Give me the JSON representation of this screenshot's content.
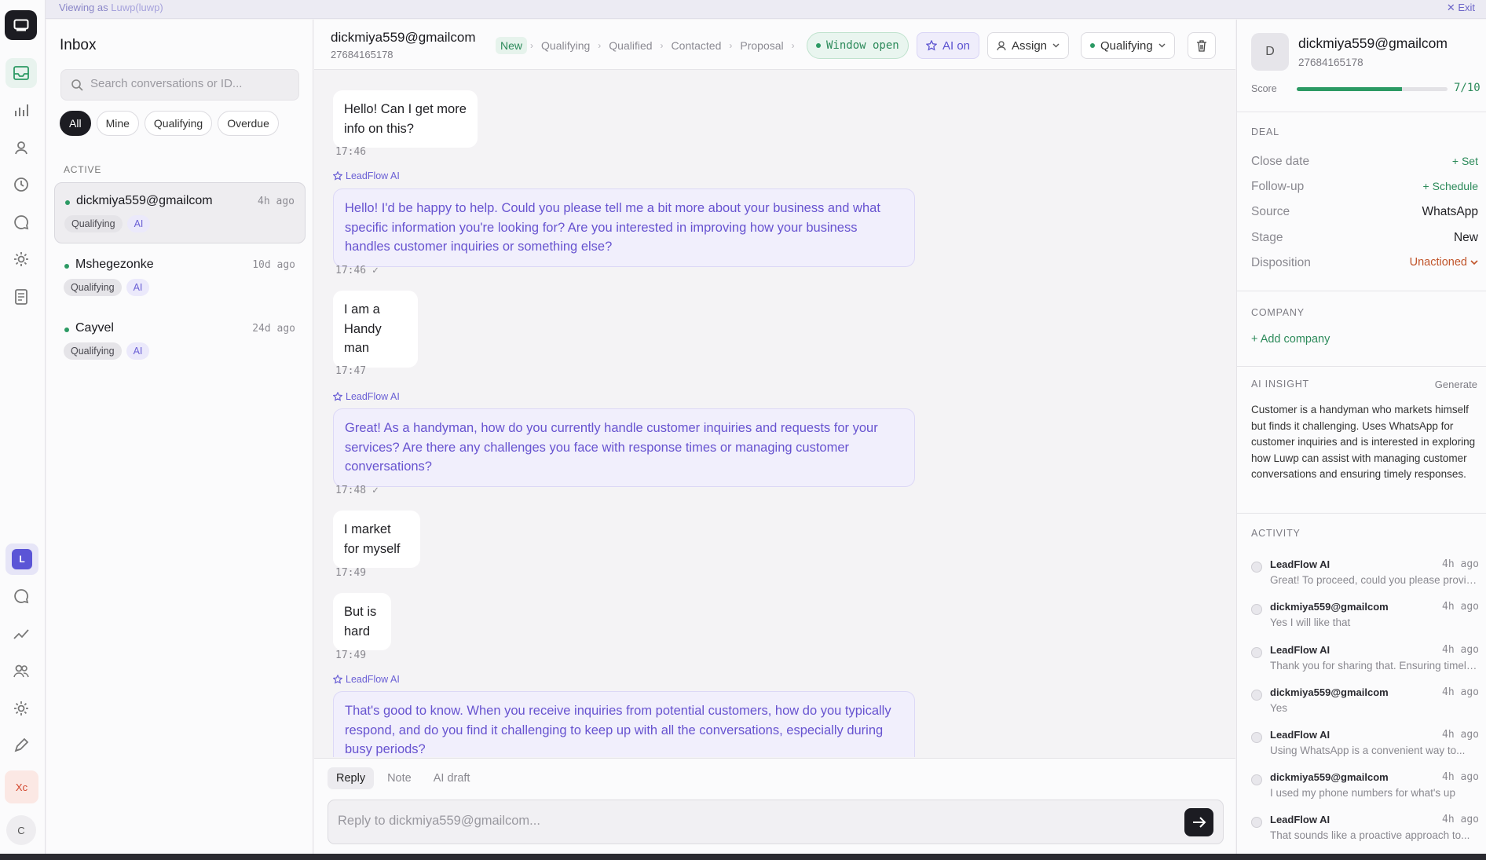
{
  "topbar": {
    "viewing_prefix": "Viewing as ",
    "viewing_user": "Luwp(luwp)",
    "exit_label": "Exit"
  },
  "inbox": {
    "title": "Inbox",
    "search_placeholder": "Search conversations or ID...",
    "filters": [
      "All",
      "Mine",
      "Qualifying",
      "Overdue"
    ],
    "section_label": "ACTIVE",
    "conversations": [
      {
        "name": "dickmiya559@gmailcom",
        "time": "4h ago",
        "stage": "Qualifying",
        "ai": "AI"
      },
      {
        "name": "Mshegezonke",
        "time": "10d ago",
        "stage": "Qualifying",
        "ai": "AI"
      },
      {
        "name": "Cayvel",
        "time": "24d ago",
        "stage": "Qualifying",
        "ai": "AI"
      }
    ]
  },
  "header": {
    "name": "dickmiya559@gmailcom",
    "phone": "27684165178",
    "stages": [
      "New",
      "Qualifying",
      "Qualified",
      "Contacted",
      "Proposal"
    ],
    "window_label": "Window open",
    "ai_label": "AI on",
    "assign_label": "Assign",
    "stage_select": "Qualifying"
  },
  "messages": [
    {
      "text": "Hello! Can I get more info on this?",
      "time": "17:46"
    },
    {
      "sender": "LeadFlow AI",
      "text": "Hello! I'd be happy to help. Could you please tell me a bit more about your business and what specific information you're looking for? Are you interested in improving how your business handles customer inquiries or something else?",
      "time": "17:46 ✓"
    },
    {
      "text": "I am a Handy man",
      "time": "17:47"
    },
    {
      "sender": "LeadFlow AI",
      "text": "Great! As a handyman, how do you currently handle customer inquiries and requests for your services? Are there any challenges you face with response times or managing customer conversations?",
      "time": "17:48 ✓"
    },
    {
      "text": "I market for myself",
      "time": "17:49"
    },
    {
      "text": "But is hard",
      "time": "17:49"
    },
    {
      "sender": "LeadFlow AI",
      "text": "That's good to know. When you receive inquiries from potential customers, how do you typically respond, and do you find it challenging to keep up with all the conversations, especially during busy periods?"
    }
  ],
  "composer": {
    "tabs": [
      "Reply",
      "Note",
      "AI draft"
    ],
    "placeholder": "Reply to dickmiya559@gmailcom..."
  },
  "contact": {
    "initial": "D",
    "name": "dickmiya559@gmailcom",
    "phone": "27684165178",
    "score_label": "Score",
    "score_value": "7/10",
    "score_fraction": 0.7,
    "deal_heading": "DEAL",
    "deal": [
      {
        "key": "Close date",
        "value": "+ Set"
      },
      {
        "key": "Follow-up",
        "value": "+ Schedule"
      },
      {
        "key": "Source",
        "value": "WhatsApp"
      },
      {
        "key": "Stage",
        "value": "New"
      },
      {
        "key": "Disposition",
        "value": "Unactioned"
      }
    ],
    "company_heading": "COMPANY",
    "add_company": "+ Add company",
    "insight_heading": "AI INSIGHT",
    "generate_label": "Generate",
    "insight_text": "Customer is a handyman who markets himself but finds it challenging. Uses WhatsApp for customer inquiries and is interested in exploring how Luwp can assist with managing customer conversations and ensuring timely responses.",
    "activity_heading": "ACTIVITY",
    "activity": [
      {
        "who": "LeadFlow AI",
        "time": "4h ago",
        "text": "Great! To proceed, could you please provide..."
      },
      {
        "who": "dickmiya559@gmailcom",
        "time": "4h ago",
        "text": "Yes I will like that"
      },
      {
        "who": "LeadFlow AI",
        "time": "4h ago",
        "text": "Thank you for sharing that. Ensuring timely..."
      },
      {
        "who": "dickmiya559@gmailcom",
        "time": "4h ago",
        "text": "Yes"
      },
      {
        "who": "LeadFlow AI",
        "time": "4h ago",
        "text": "Using WhatsApp is a convenient way to..."
      },
      {
        "who": "dickmiya559@gmailcom",
        "time": "4h ago",
        "text": "I used my phone numbers for what's up"
      },
      {
        "who": "LeadFlow AI",
        "time": "4h ago",
        "text": "That sounds like a proactive approach to..."
      }
    ]
  },
  "colors": {
    "accent_green": "#2c9a64",
    "ai_purple": "#6753d0",
    "disposition_orange": "#c0542a"
  }
}
